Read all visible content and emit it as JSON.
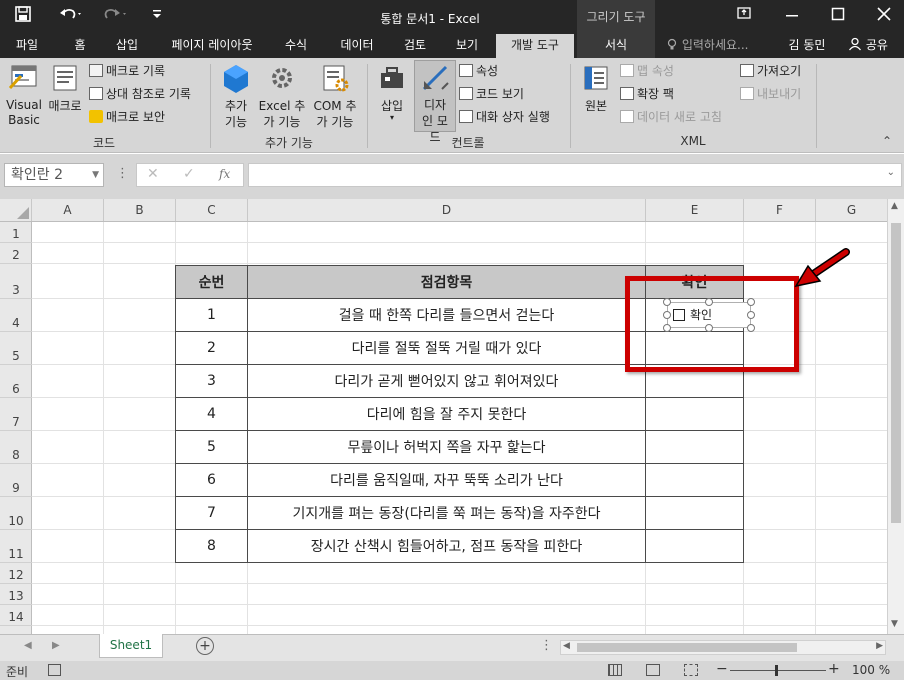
{
  "window": {
    "title": "통합 문서1 - Excel",
    "context_tool": "그리기 도구"
  },
  "tabs": [
    "파일",
    "홈",
    "삽입",
    "페이지 레이아웃",
    "수식",
    "데이터",
    "검토",
    "보기",
    "개발 도구",
    "서식"
  ],
  "active_tab": "개발 도구",
  "tell_me": "입력하세요...",
  "user": "김 동민",
  "share": "공유",
  "ribbon": {
    "code": {
      "label": "코드",
      "visual_basic": "Visual Basic",
      "macro": "매크로",
      "record": "매크로 기록",
      "relative": "상대 참조로 기록",
      "security": "매크로 보안"
    },
    "addins": {
      "label": "추가 기능",
      "addins": "추가 기능",
      "excel_addins": "Excel 추가 기능",
      "com_addins": "COM 추가 기능"
    },
    "controls": {
      "label": "컨트롤",
      "insert": "삽입",
      "design_mode": "디자인 모드",
      "properties": "속성",
      "view_code": "코드 보기",
      "dialog": "대화 상자 실행"
    },
    "xml": {
      "label": "XML",
      "source": "원본",
      "map_props": "맵 속성",
      "expansion": "확장 팩",
      "refresh": "데이터 새로 고침",
      "import": "가져오기",
      "export": "내보내기"
    }
  },
  "name_box": "확인란 2",
  "columns": [
    "A",
    "B",
    "C",
    "D",
    "E",
    "F",
    "G"
  ],
  "rows": [
    "1",
    "2",
    "3",
    "4",
    "5",
    "6",
    "7",
    "8",
    "9",
    "10",
    "11",
    "12",
    "13",
    "14"
  ],
  "table": {
    "headers": [
      "순번",
      "점검항목",
      "확인"
    ],
    "rows": [
      {
        "no": "1",
        "item": "걸을 때 한쪽 다리를 들으면서 걷는다"
      },
      {
        "no": "2",
        "item": "다리를 절뚝 절뚝 거릴 때가 있다"
      },
      {
        "no": "3",
        "item": "다리가 곧게 뻗어있지 않고 휘어져있다"
      },
      {
        "no": "4",
        "item": "다리에 힘을 잘 주지 못한다"
      },
      {
        "no": "5",
        "item": "무릎이나 허벅지 쪽을 자꾸 핥는다"
      },
      {
        "no": "6",
        "item": "다리를 움직일때, 자꾸 뚝뚝 소리가 난다"
      },
      {
        "no": "7",
        "item": "기지개를 펴는 동장(다리를 쭉 펴는 동작)을 자주한다"
      },
      {
        "no": "8",
        "item": "장시간 산책시 힘들어하고, 점프 동작을 피한다"
      }
    ]
  },
  "checkbox_label": "확인",
  "sheet_tab": "Sheet1",
  "status": {
    "ready": "준비",
    "zoom": "100 %"
  },
  "colors": {
    "titlebar": "#262626",
    "ribbon": "#d6d6d6",
    "highlight": "#cc0000",
    "sheet_tab_text": "#217346"
  }
}
